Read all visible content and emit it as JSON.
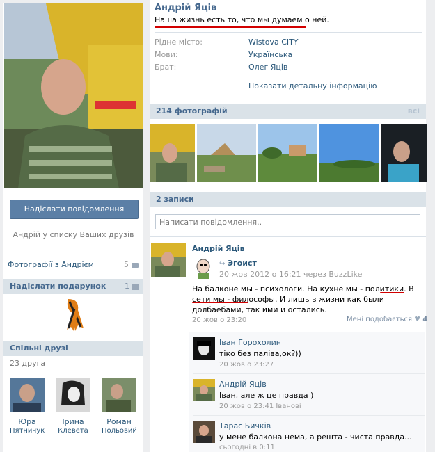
{
  "profile": {
    "name": "Андрій Яців",
    "status": "Наша жизнь есть то, что мы думаем о ней.",
    "info": [
      {
        "label": "Рідне місто:",
        "value": "Wistova CITY"
      },
      {
        "label": "Мови:",
        "value": "Українська"
      },
      {
        "label": "Брат:",
        "value": "Олег Яців"
      }
    ],
    "show_details": "Показати детальну інформацію"
  },
  "left": {
    "send_message": "Надіслати повідомлення",
    "in_friends": "Андрій у списку Ваших друзів",
    "photos_with": "Фотографії з Андрієм",
    "photos_with_count": "5",
    "gift_header": "Надіслати подарунок",
    "gift_count": "1",
    "common_friends_header": "Спільні друзі",
    "common_friends_count": "23 друга",
    "friends": [
      {
        "first": "Юра",
        "last": "Пятничук"
      },
      {
        "first": "Ірина",
        "last": "Клевета"
      },
      {
        "first": "Роман",
        "last": "Польовий"
      }
    ]
  },
  "photos": {
    "header": "214 фотографій",
    "all": "всі"
  },
  "wall": {
    "header": "2 записи",
    "input_placeholder": "Написати повідомлення..",
    "post": {
      "author": "Андрій Яців",
      "repost_from": "Эгоист",
      "repost_meta": "20 жов 2012 о 16:21 через BuzzLike",
      "text": "На балконе мы - психологи. На кухне мы - политики. В сети мы - философы. И лишь в жизни как были долбаебами, так ими и остались.",
      "date": "20 жов о 23:20",
      "likes_label": "Мені подобається",
      "likes_count": "4"
    },
    "comments": [
      {
        "author": "Іван Горохолин",
        "text": "тіко без паліва,ок?))",
        "meta": "20 жов о 23:27"
      },
      {
        "author": "Андрій Яців",
        "text": "Іван, але ж це правда )",
        "meta": "20 жов о 23:41 Іванові"
      },
      {
        "author": "Тарас Бичків",
        "text": "у мене балкона нема, а решта - чиста правда...",
        "meta": "сьогодні в 0:11"
      }
    ]
  }
}
